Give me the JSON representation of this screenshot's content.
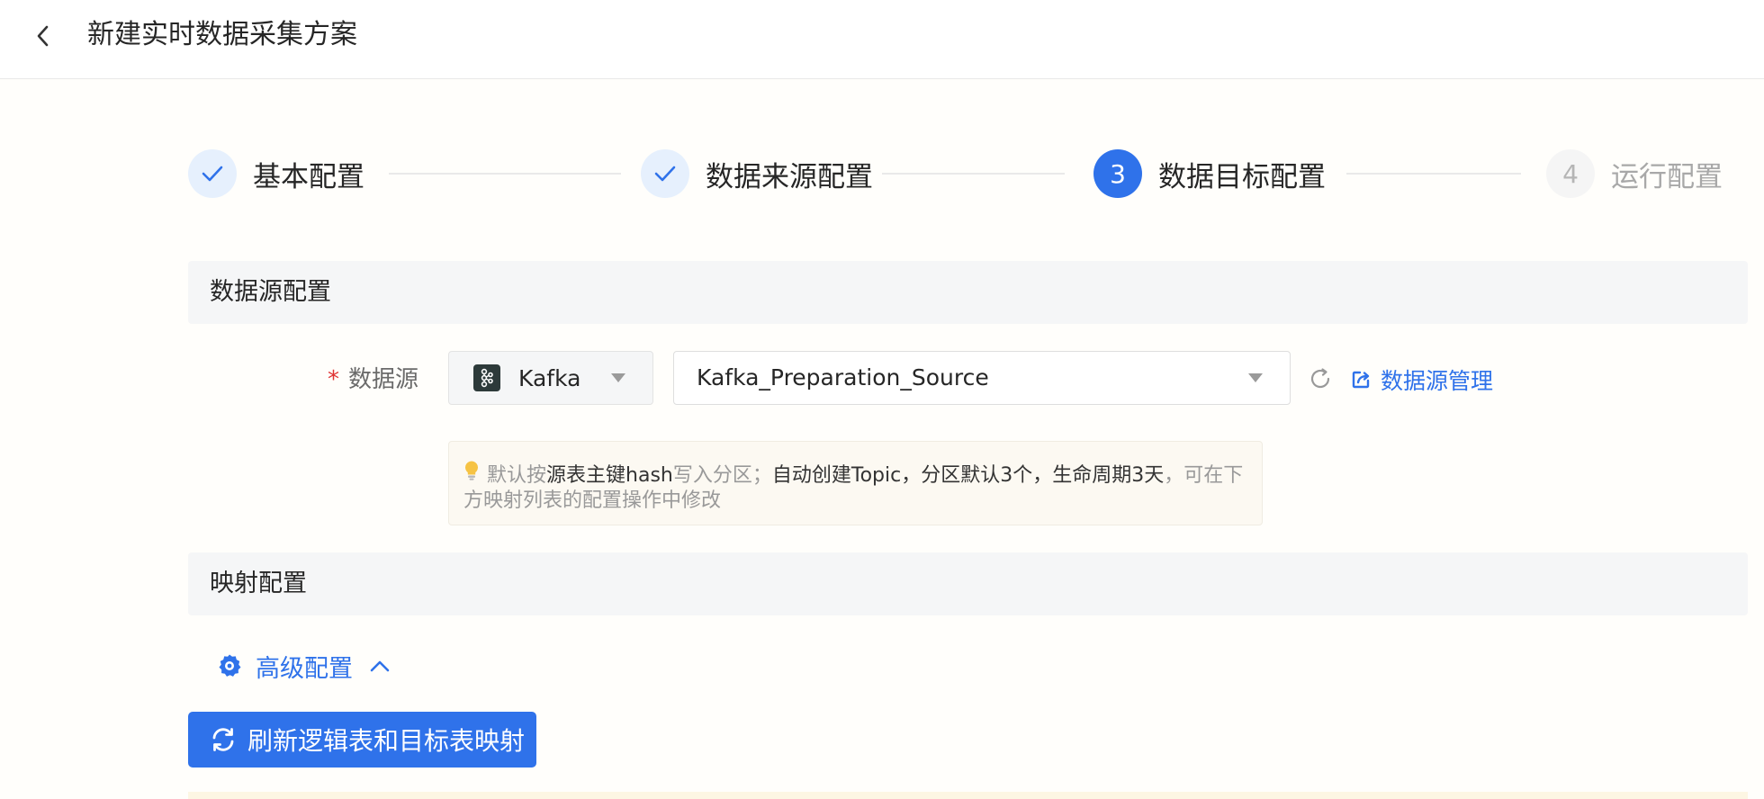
{
  "header": {
    "title": "新建实时数据采集方案"
  },
  "steps": [
    {
      "number": "1",
      "label": "基本配置",
      "status": "done"
    },
    {
      "number": "2",
      "label": "数据来源配置",
      "status": "done"
    },
    {
      "number": "3",
      "label": "数据目标配置",
      "status": "active"
    },
    {
      "number": "4",
      "label": "运行配置",
      "status": "pending"
    }
  ],
  "datasource_section": {
    "title": "数据源配置",
    "label": "数据源",
    "required_mark": "*",
    "type_value": "Kafka",
    "source_value": "Kafka_Preparation_Source",
    "manage_link": "数据源管理"
  },
  "tip": {
    "part1": "默认按",
    "part2": "源表主键hash",
    "part3": "写入分区；",
    "part4": "自动创建Topic，分区默认3个，生命周期3天",
    "part5": "，可在下方映射列表的配置操作中修改"
  },
  "mapping_section": {
    "title": "映射配置"
  },
  "advanced": {
    "label": "高级配置"
  },
  "refresh_button": {
    "label": "刷新逻辑表和目标表映射"
  },
  "colors": {
    "primary": "#2f72ea",
    "required": "#e03434"
  }
}
